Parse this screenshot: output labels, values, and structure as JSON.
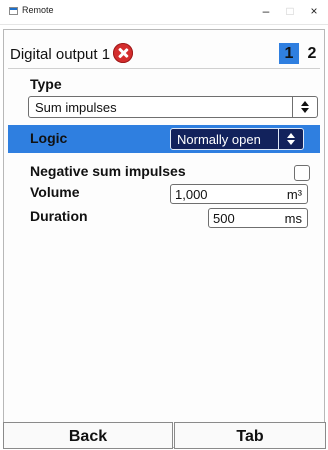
{
  "window": {
    "title": "Remote",
    "minimize": "–",
    "maximize": "□",
    "close": "×"
  },
  "header": {
    "title": "Digital output 1",
    "tabs": [
      "1",
      "2"
    ],
    "active_tab": "1"
  },
  "form": {
    "type_label": "Type",
    "type_value": "Sum impulses",
    "logic_label": "Logic",
    "logic_value": "Normally open",
    "negative_label": "Negative sum impulses",
    "negative_checked": false,
    "volume_label": "Volume",
    "volume_value": "1,000",
    "volume_unit": "m³",
    "duration_label": "Duration",
    "duration_value": "500",
    "duration_unit": "ms"
  },
  "footer": {
    "back_label": "Back",
    "tab_label": "Tab"
  },
  "colors": {
    "highlight": "#2f7fe0",
    "dropdown_dark": "#12225c",
    "error": "#d42d2d"
  }
}
